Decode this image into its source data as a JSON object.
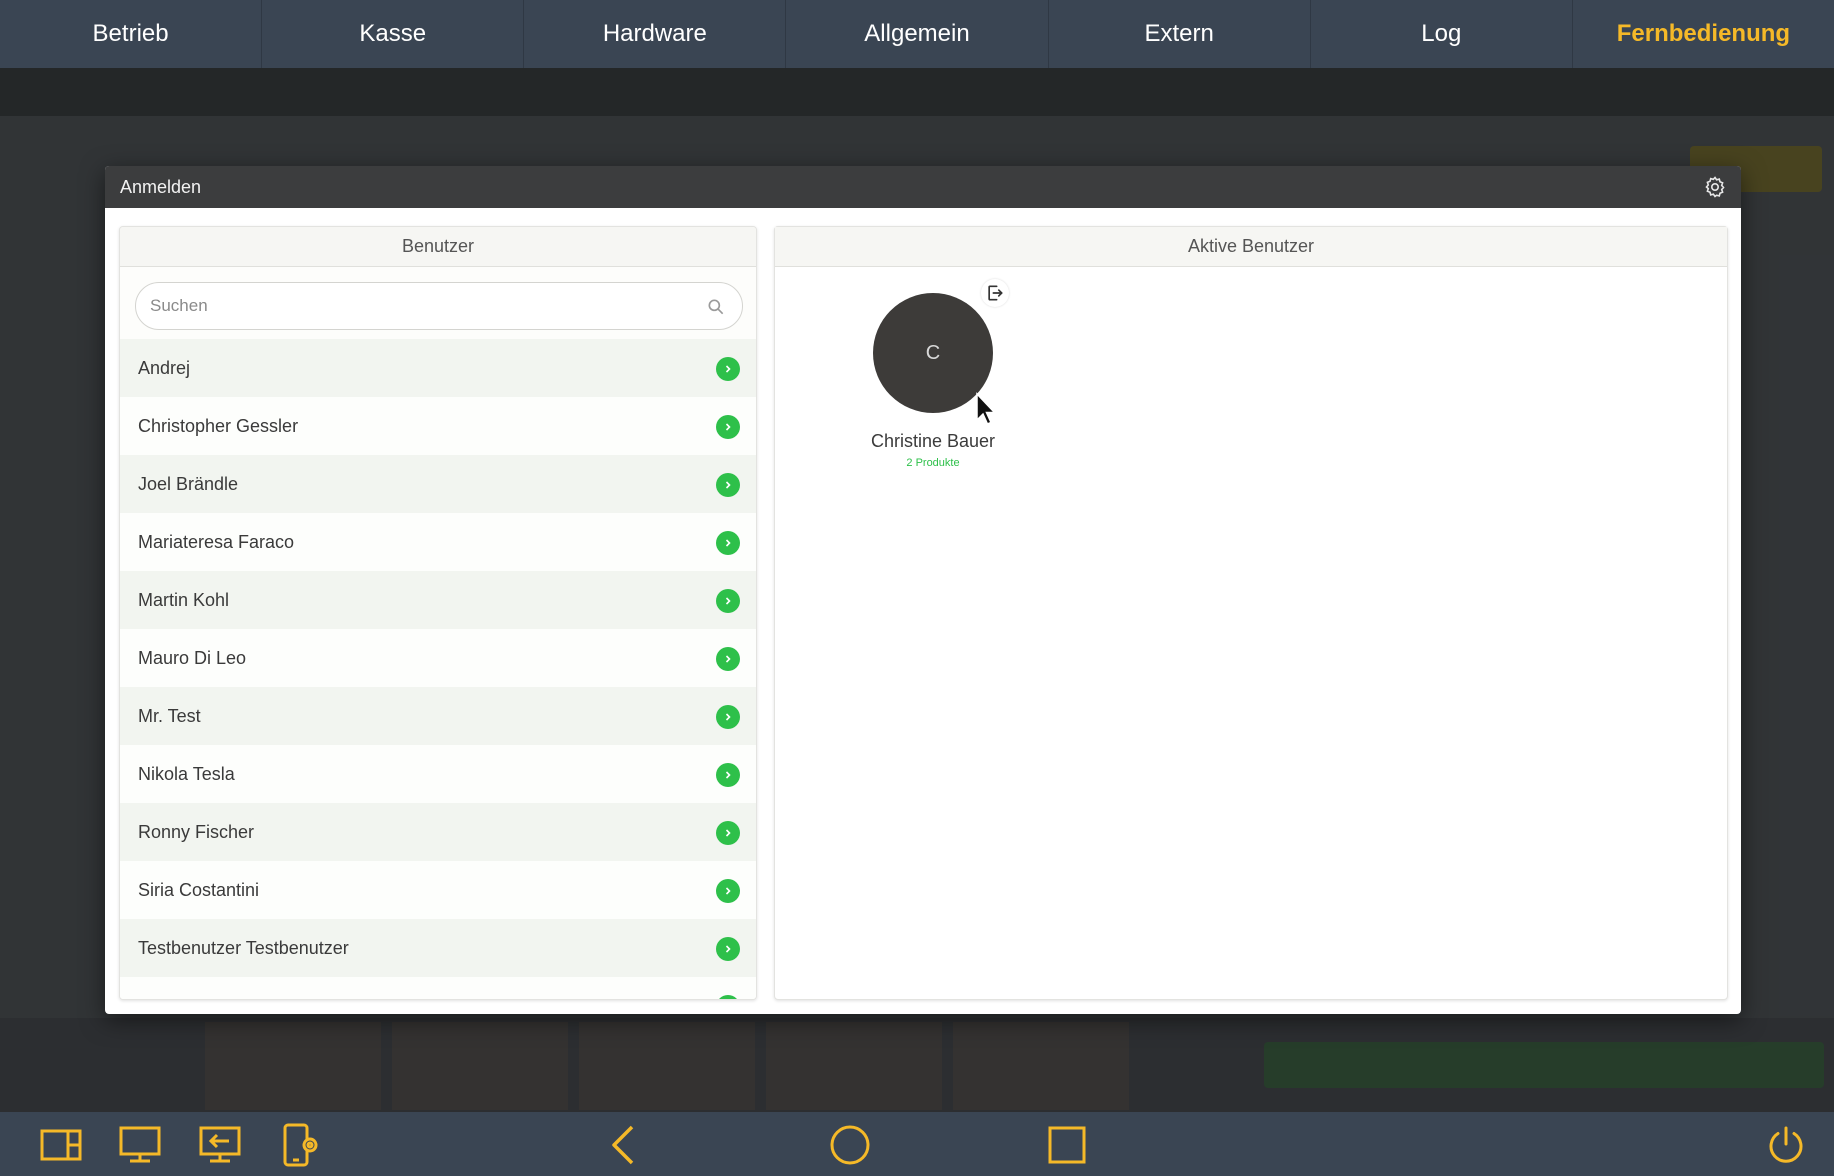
{
  "top_tabs": [
    {
      "label": "Betrieb",
      "active": false
    },
    {
      "label": "Kasse",
      "active": false
    },
    {
      "label": "Hardware",
      "active": false
    },
    {
      "label": "Allgemein",
      "active": false
    },
    {
      "label": "Extern",
      "active": false
    },
    {
      "label": "Log",
      "active": false
    },
    {
      "label": "Fernbedienung",
      "active": true
    }
  ],
  "modal": {
    "title": "Anmelden",
    "users_panel": {
      "title": "Benutzer",
      "search_placeholder": "Suchen",
      "users": [
        "Andrej",
        "Christopher Gessler",
        "Joel Brändle",
        "Mariateresa Faraco",
        "Martin Kohl",
        "Mauro Di Leo",
        "Mr. Test",
        "Nikola Tesla",
        "Ronny Fischer",
        "Siria Costantini",
        "Testbenutzer Testbenutzer"
      ]
    },
    "active_panel": {
      "title": "Aktive Benutzer",
      "active_user": {
        "initial": "C",
        "name": "Christine Bauer",
        "subtitle": "2 Produkte"
      }
    }
  },
  "colors": {
    "nav_bg": "#3a4553",
    "active_tab": "#f5b928",
    "accent_green": "#2ec04a",
    "icon_yellow": "#f5b928"
  },
  "bottom_bar_icons": [
    "panel-layout-icon",
    "monitor-icon",
    "screen-switch-icon",
    "device-settings-icon",
    "back-icon",
    "home-icon",
    "recents-icon",
    "power-icon"
  ]
}
